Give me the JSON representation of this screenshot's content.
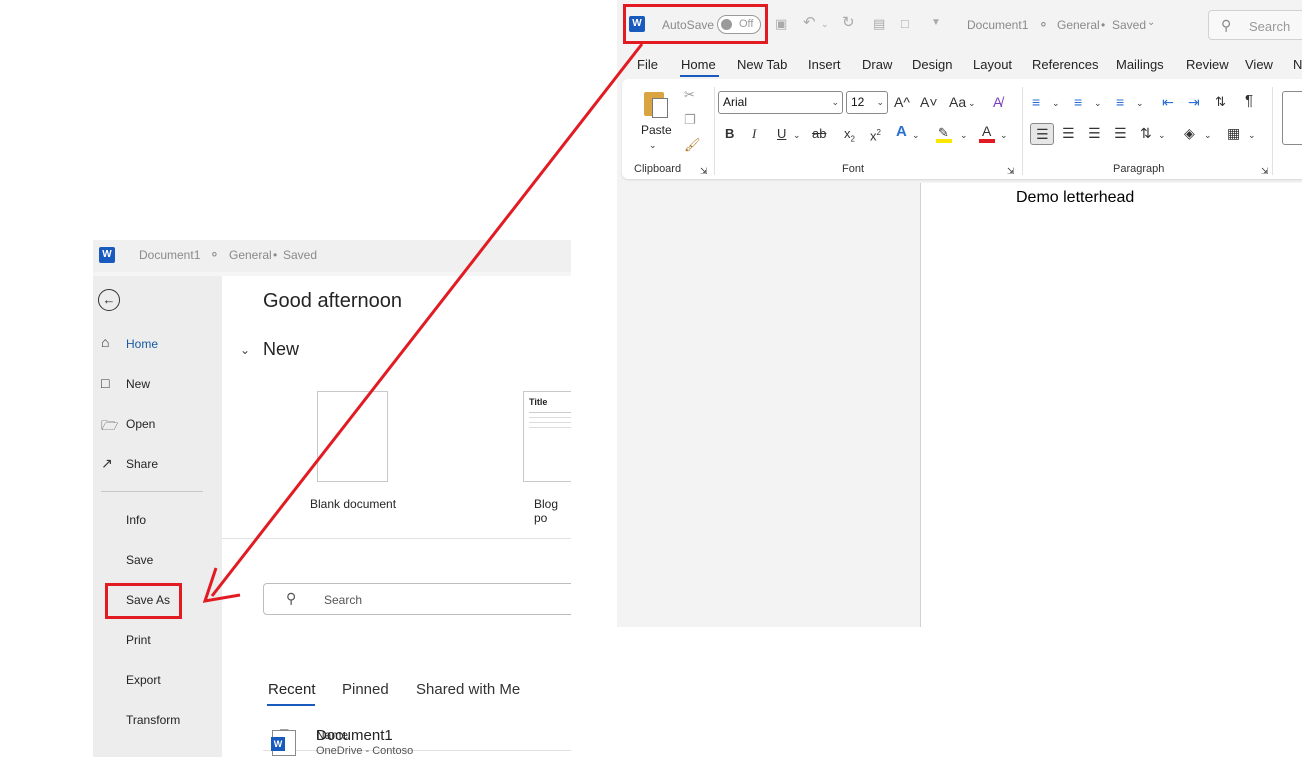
{
  "word": {
    "autosave_label": "AutoSave",
    "autosave_state": "Off",
    "doc_title": "Document1",
    "sensitivity": "General",
    "save_state": "Saved",
    "search_placeholder": "Search",
    "tabs": [
      "File",
      "Home",
      "New Tab",
      "Insert",
      "Draw",
      "Design",
      "Layout",
      "References",
      "Mailings",
      "Review",
      "View",
      "N"
    ],
    "ribbon": {
      "paste_label": "Paste",
      "clipboard_label": "Clipboard",
      "font_label": "Font",
      "paragraph_label": "Paragraph",
      "font_name": "Arial",
      "font_size": "12",
      "bold": "B",
      "italic": "I",
      "underline": "U",
      "strike": "ab",
      "subscript": "x2",
      "superscript": "x2",
      "grow_font": "A^",
      "shrink_font": "A˅",
      "change_case": "Aa",
      "pilcrow": "¶"
    },
    "document_text": "Demo letterhead"
  },
  "backstage": {
    "doc_title": "Document1",
    "sensitivity": "General",
    "save_state": "Saved",
    "nav": [
      "Home",
      "New",
      "Open",
      "Share",
      "Info",
      "Save",
      "Save As",
      "Print",
      "Export",
      "Transform"
    ],
    "greeting": "Good afternoon",
    "new_header": "New",
    "templates": [
      {
        "label": "Blank document"
      },
      {
        "label": "Blog po",
        "thumb_title": "Title"
      }
    ],
    "search_placeholder": "Search",
    "file_tabs": [
      "Recent",
      "Pinned",
      "Shared with Me"
    ],
    "name_header": "Name",
    "recent_files": [
      {
        "name": "Document1",
        "location": "OneDrive - Contoso"
      }
    ]
  },
  "colors": {
    "annotation_red": "#e21b23",
    "word_blue": "#185abd",
    "selected_nav": "#1a5aa3"
  }
}
